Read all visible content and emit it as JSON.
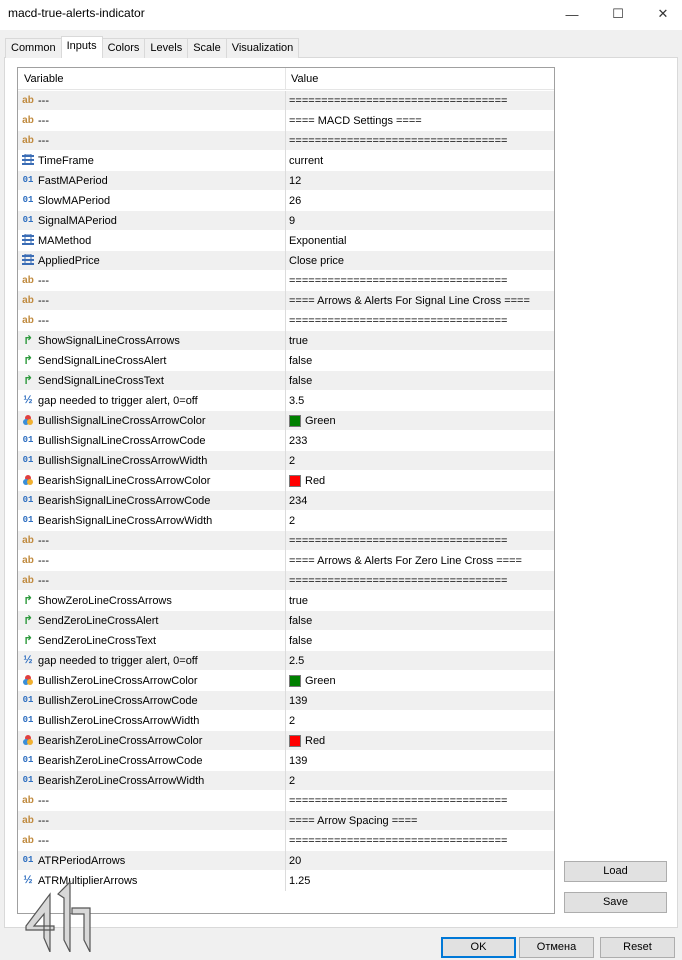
{
  "window": {
    "title": "macd-true-alerts-indicator",
    "minimize_glyph": "—",
    "maximize_glyph": "☐",
    "close_glyph": "✕"
  },
  "tabs": [
    {
      "label": "Common"
    },
    {
      "label": "Inputs"
    },
    {
      "label": "Colors"
    },
    {
      "label": "Levels"
    },
    {
      "label": "Scale"
    },
    {
      "label": "Visualization"
    }
  ],
  "active_tab": "Inputs",
  "grid": {
    "header": {
      "variable": "Variable",
      "value": "Value"
    },
    "rows": [
      {
        "icon": "ab",
        "name": "---",
        "value": "=================================="
      },
      {
        "icon": "ab",
        "name": "---",
        "value": "==== MACD Settings ===="
      },
      {
        "icon": "ab",
        "name": "---",
        "value": "=================================="
      },
      {
        "icon": "enum",
        "name": "TimeFrame",
        "value": "current"
      },
      {
        "icon": "num",
        "name": "FastMAPeriod",
        "value": "12"
      },
      {
        "icon": "num",
        "name": "SlowMAPeriod",
        "value": "26"
      },
      {
        "icon": "num",
        "name": "SignalMAPeriod",
        "value": "9"
      },
      {
        "icon": "enum",
        "name": "MAMethod",
        "value": "Exponential"
      },
      {
        "icon": "enum",
        "name": "AppliedPrice",
        "value": "Close price"
      },
      {
        "icon": "ab",
        "name": "---",
        "value": "=================================="
      },
      {
        "icon": "ab",
        "name": "---",
        "value": "==== Arrows & Alerts For Signal Line Cross ===="
      },
      {
        "icon": "ab",
        "name": "---",
        "value": "=================================="
      },
      {
        "icon": "bool",
        "name": "ShowSignalLineCrossArrows",
        "value": "true"
      },
      {
        "icon": "bool",
        "name": "SendSignalLineCrossAlert",
        "value": "false"
      },
      {
        "icon": "bool",
        "name": "SendSignalLineCrossText",
        "value": "false"
      },
      {
        "icon": "frac",
        "name": "gap needed to trigger alert, 0=off",
        "value": "3.5"
      },
      {
        "icon": "color",
        "name": "BullishSignalLineCrossArrowColor",
        "value": "Green",
        "swatch": "#008000"
      },
      {
        "icon": "num",
        "name": "BullishSignalLineCrossArrowCode",
        "value": "233"
      },
      {
        "icon": "num",
        "name": "BullishSignalLineCrossArrowWidth",
        "value": "2"
      },
      {
        "icon": "color",
        "name": "BearishSignalLineCrossArrowColor",
        "value": "Red",
        "swatch": "#ff0000"
      },
      {
        "icon": "num",
        "name": "BearishSignalLineCrossArrowCode",
        "value": "234"
      },
      {
        "icon": "num",
        "name": "BearishSignalLineCrossArrowWidth",
        "value": "2"
      },
      {
        "icon": "ab",
        "name": "---",
        "value": "=================================="
      },
      {
        "icon": "ab",
        "name": "---",
        "value": "==== Arrows & Alerts For Zero Line Cross ===="
      },
      {
        "icon": "ab",
        "name": "---",
        "value": "=================================="
      },
      {
        "icon": "bool",
        "name": "ShowZeroLineCrossArrows",
        "value": "true"
      },
      {
        "icon": "bool",
        "name": "SendZeroLineCrossAlert",
        "value": "false"
      },
      {
        "icon": "bool",
        "name": "SendZeroLineCrossText",
        "value": "false"
      },
      {
        "icon": "frac",
        "name": "gap needed to trigger alert, 0=off",
        "value": "2.5"
      },
      {
        "icon": "color",
        "name": "BullishZeroLineCrossArrowColor",
        "value": "Green",
        "swatch": "#008000"
      },
      {
        "icon": "num",
        "name": "BullishZeroLineCrossArrowCode",
        "value": "139"
      },
      {
        "icon": "num",
        "name": "BullishZeroLineCrossArrowWidth",
        "value": "2"
      },
      {
        "icon": "color",
        "name": "BearishZeroLineCrossArrowColor",
        "value": "Red",
        "swatch": "#ff0000"
      },
      {
        "icon": "num",
        "name": "BearishZeroLineCrossArrowCode",
        "value": "139"
      },
      {
        "icon": "num",
        "name": "BearishZeroLineCrossArrowWidth",
        "value": "2"
      },
      {
        "icon": "ab",
        "name": "---",
        "value": "=================================="
      },
      {
        "icon": "ab",
        "name": "---",
        "value": "==== Arrow Spacing ===="
      },
      {
        "icon": "ab",
        "name": "---",
        "value": "=================================="
      },
      {
        "icon": "num",
        "name": "ATRPeriodArrows",
        "value": "20"
      },
      {
        "icon": "frac",
        "name": "ATRMultiplierArrows",
        "value": "1.25"
      }
    ]
  },
  "icon_glyphs": {
    "ab": "ab",
    "num": "01",
    "frac": "½",
    "bool": "↱"
  },
  "side_buttons": {
    "load": "Load",
    "save": "Save"
  },
  "bottom_buttons": {
    "ok": "OK",
    "cancel": "Отмена",
    "reset": "Reset"
  },
  "colors": {
    "row_shade": "#f0f0f0",
    "ok_border": "#0078d7",
    "string_icon": "#c08a3e",
    "number_icon": "#2f6fc0",
    "bool_icon": "#2e9a3e"
  }
}
